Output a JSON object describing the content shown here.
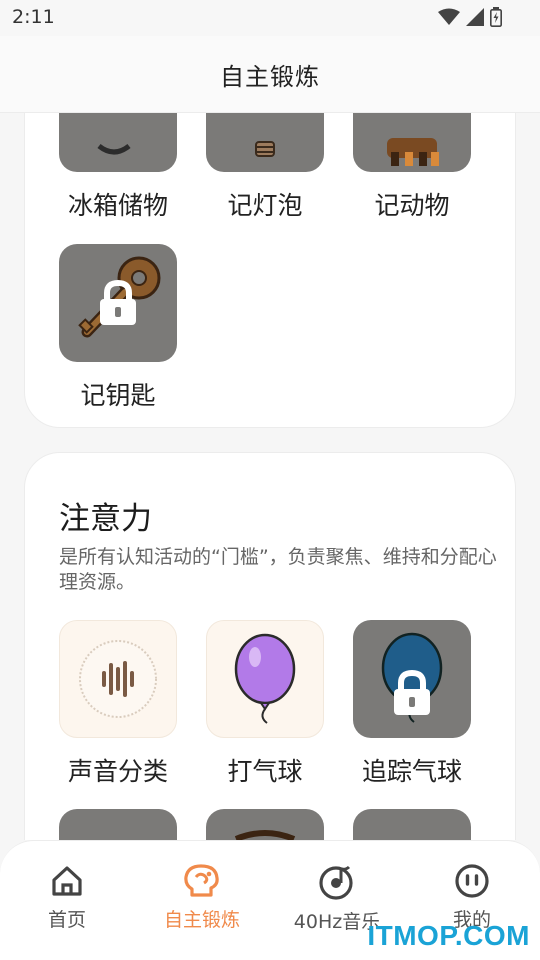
{
  "status_bar": {
    "time": "2:11",
    "icons": [
      "wifi-icon",
      "signal-icon",
      "battery-icon"
    ]
  },
  "header": {
    "title": "自主锻炼"
  },
  "memory_section": {
    "tiles": [
      {
        "label": "冰箱储物",
        "locked": false
      },
      {
        "label": "记灯泡",
        "locked": false
      },
      {
        "label": "记动物",
        "locked": false
      },
      {
        "label": "记钥匙",
        "locked": true
      }
    ]
  },
  "attention_section": {
    "title": "注意力",
    "description": "是所有认知活动的“门槛”，负责聚焦、维持和分配心理资源。",
    "tiles": [
      {
        "label": "声音分类",
        "locked": false
      },
      {
        "label": "打气球",
        "locked": false
      },
      {
        "label": "追踪气球",
        "locked": true
      }
    ]
  },
  "bottom_nav": {
    "items": [
      {
        "label": "首页",
        "icon": "home-icon",
        "active": false
      },
      {
        "label": "自主锻炼",
        "icon": "brain-icon",
        "active": true
      },
      {
        "label": "40Hz音乐",
        "icon": "music-disc-icon",
        "active": false
      },
      {
        "label": "我的",
        "icon": "profile-face-icon",
        "active": false
      }
    ]
  },
  "colors": {
    "accent": "#f08a4b",
    "tile_gray": "#7b7a78",
    "watermark": "#1aa3d6"
  },
  "watermark": "ITMOP.COM"
}
